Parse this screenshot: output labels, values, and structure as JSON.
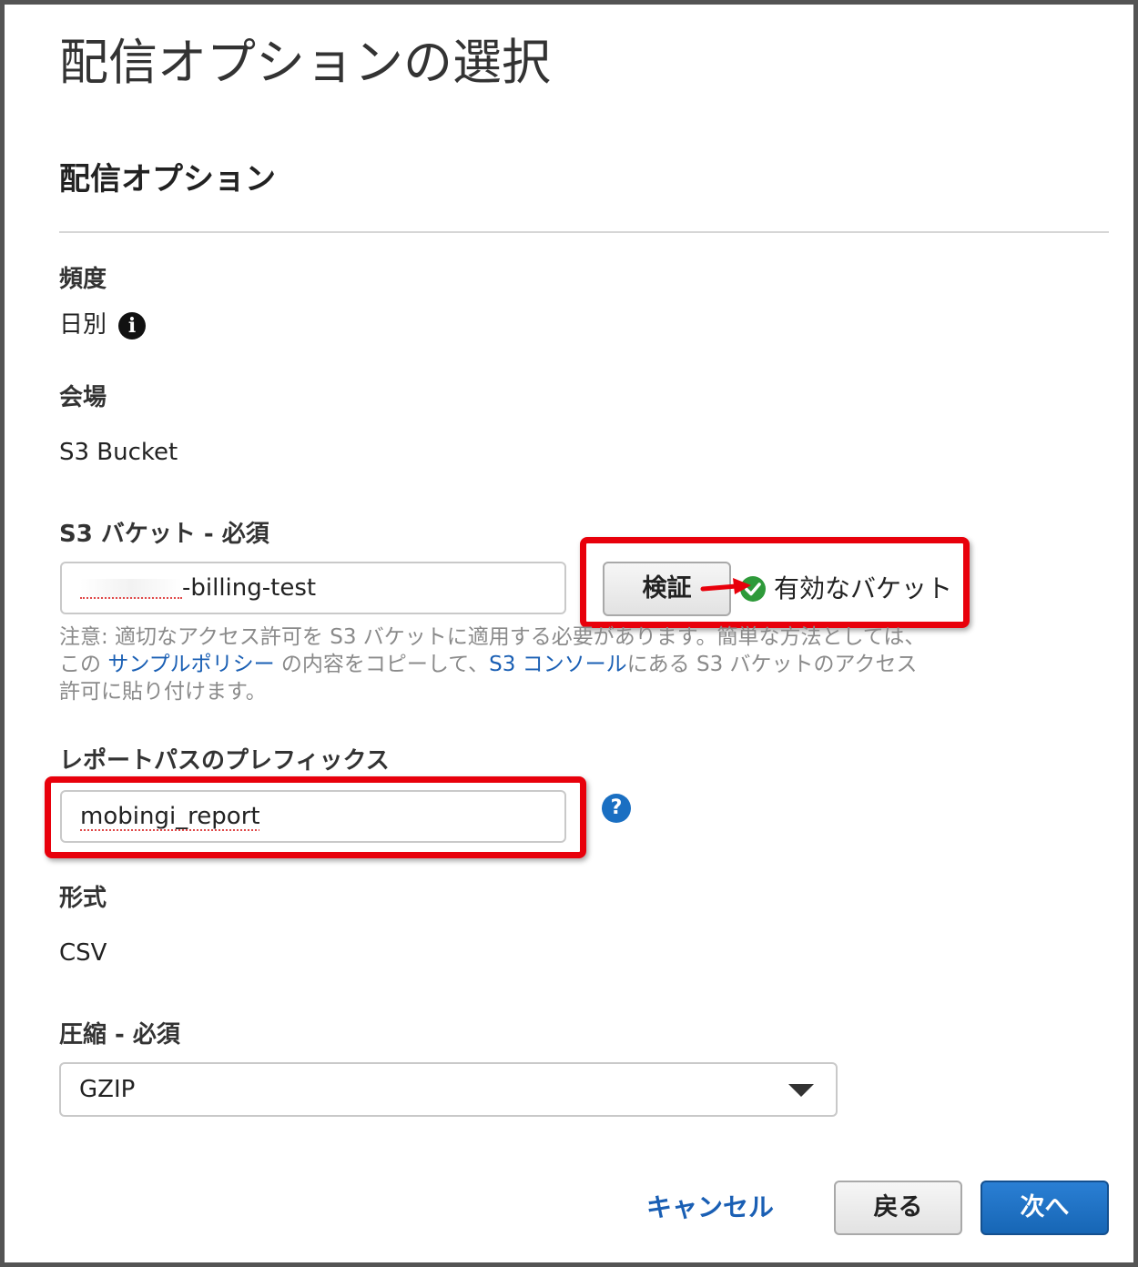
{
  "page": {
    "title": "配信オプションの選択",
    "section_title": "配信オプション"
  },
  "frequency": {
    "label": "頻度",
    "value": "日別",
    "info_icon": "info-icon"
  },
  "destination": {
    "label": "会場",
    "value": "S3 Bucket"
  },
  "s3_bucket": {
    "label": "S3 バケット - 必須",
    "value_visible": "-billing-test",
    "verify_button": "検証",
    "status_text": "有効なバケット",
    "status_icon": "check-circle-icon",
    "status_color": "#2e9a3a"
  },
  "help": {
    "line1": "注意: 適切なアクセス許可を S3 バケットに適用する必要があります。簡単な方法としては、",
    "line2_before": "この ",
    "sample_policy_link": "サンプルポリシー",
    "line2_middle": " の内容をコピーして、",
    "s3_console_link": "S3 コンソール",
    "line2_after": "にある S3 バケットのアクセス",
    "line3": "許可に貼り付けます。"
  },
  "report_prefix": {
    "label": "レポートパスのプレフィックス",
    "value": "mobingi_report",
    "help_icon": "question-circle-icon"
  },
  "format": {
    "label": "形式",
    "value": "CSV"
  },
  "compression": {
    "label": "圧縮 - 必須",
    "selected": "GZIP"
  },
  "footer": {
    "cancel_label": "キャンセル",
    "back_label": "戻る",
    "next_label": "次へ"
  },
  "colors": {
    "link": "#1a5fb4",
    "primary_button": "#1f72c6",
    "annotation_red": "#e8000b"
  }
}
